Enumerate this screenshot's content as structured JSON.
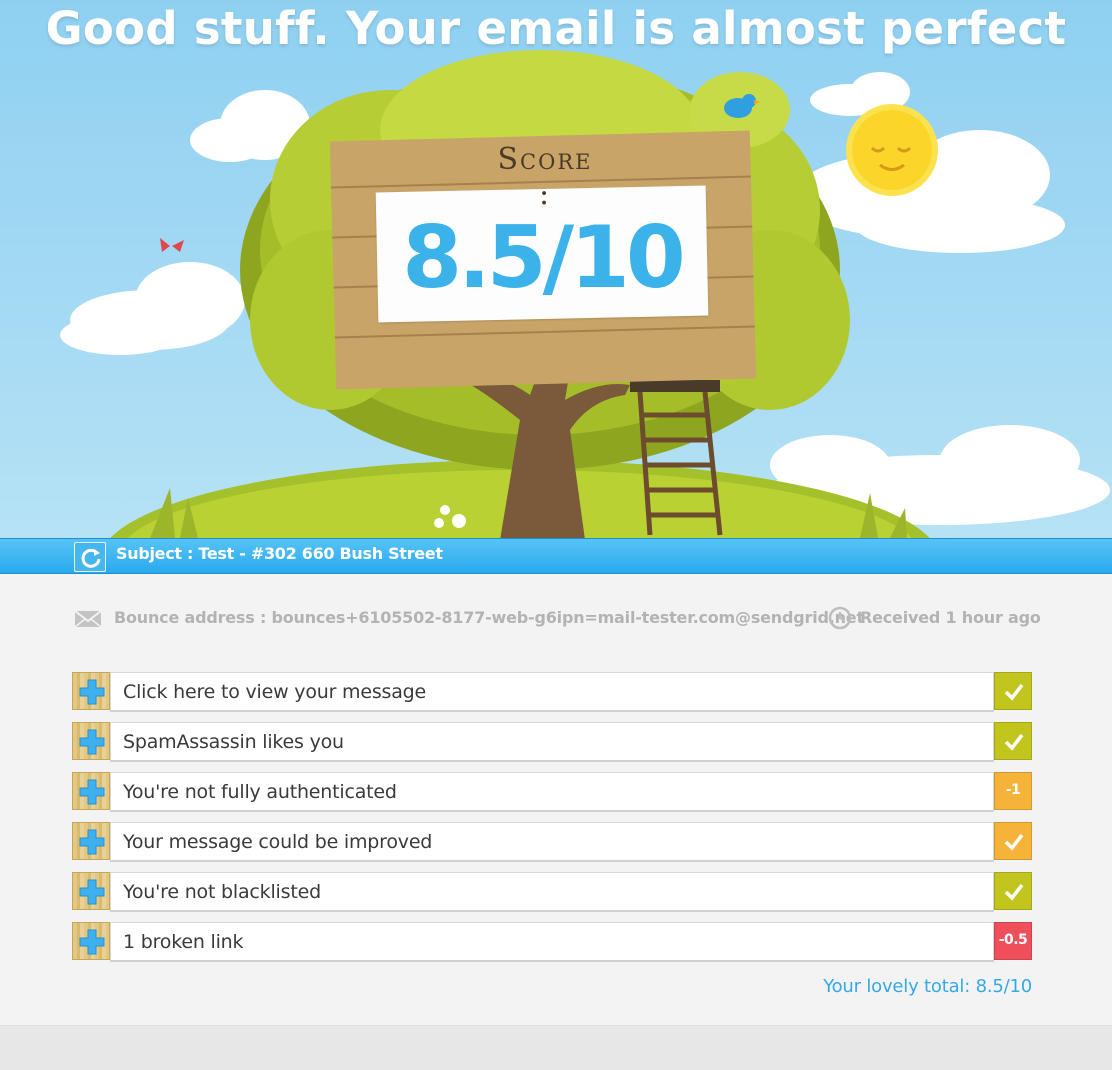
{
  "hero": {
    "title": "Good stuff. Your email is almost perfect",
    "score_caption": "Score :",
    "score_value": "8.5/10"
  },
  "subject": {
    "text": "Subject : Test - #302 660 Bush Street",
    "refresh_icon": "refresh-icon"
  },
  "info": {
    "bounce": "Bounce address : bounces+6105502-8177-web-g6ipn=mail-tester.com@sendgrid.net",
    "received": "Received 1 hour ago",
    "mail_icon": "envelope-icon",
    "clock_icon": "clock-icon"
  },
  "results": [
    {
      "label": "Click here to view your message",
      "status": "check",
      "status_text": "",
      "color": "#c2c51d"
    },
    {
      "label": "SpamAssassin likes you",
      "status": "check",
      "status_text": "",
      "color": "#c2c51d"
    },
    {
      "label": "You're not fully authenticated",
      "status": "text",
      "status_text": "-1",
      "color": "#f5b33a"
    },
    {
      "label": "Your message could be improved",
      "status": "check",
      "status_text": "",
      "color": "#f5b33a"
    },
    {
      "label": "You're not blacklisted",
      "status": "check",
      "status_text": "",
      "color": "#c2c51d"
    },
    {
      "label": "1 broken link",
      "status": "text",
      "status_text": "-0.5",
      "color": "#ef4f5a"
    }
  ],
  "total": "Your lovely total: 8.5/10",
  "colors": {
    "accent_blue": "#3bb2ea",
    "pass_green": "#c2c51d",
    "warn_orange": "#f5b33a",
    "fail_red": "#ef4f5a"
  }
}
